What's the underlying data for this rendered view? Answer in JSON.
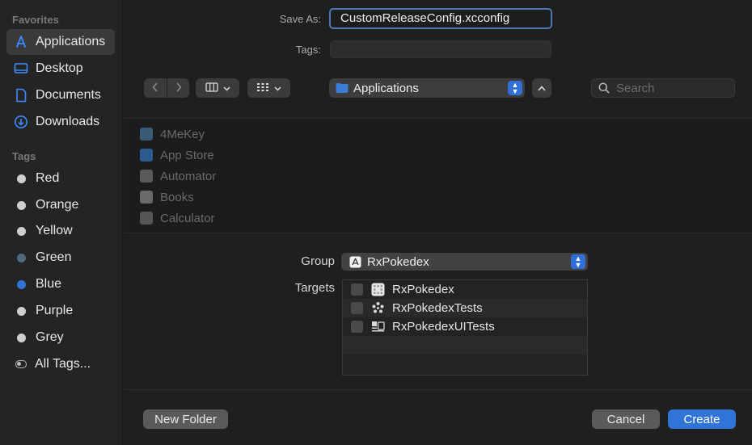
{
  "sidebar": {
    "favorites_header": "Favorites",
    "favorites": [
      {
        "label": "Applications",
        "icon": "applications-icon"
      },
      {
        "label": "Desktop",
        "icon": "desktop-icon"
      },
      {
        "label": "Documents",
        "icon": "document-icon"
      },
      {
        "label": "Downloads",
        "icon": "downloads-icon"
      }
    ],
    "tags_header": "Tags",
    "tags": [
      {
        "label": "Red",
        "color": "#cfcfcf"
      },
      {
        "label": "Orange",
        "color": "#cfcfcf"
      },
      {
        "label": "Yellow",
        "color": "#cfcfcf"
      },
      {
        "label": "Green",
        "color": "#4f6a7e"
      },
      {
        "label": "Blue",
        "color": "#2f74d6"
      },
      {
        "label": "Purple",
        "color": "#cfcfcf"
      },
      {
        "label": "Grey",
        "color": "#cfcfcf"
      }
    ],
    "all_tags": "All Tags..."
  },
  "form": {
    "save_as_label": "Save As:",
    "save_as_value": "CustomReleaseConfig.xcconfig",
    "tags_label": "Tags:"
  },
  "toolbar": {
    "location": "Applications",
    "search_placeholder": "Search"
  },
  "browser": {
    "apps": [
      "4MeKey",
      "App Store",
      "Automator",
      "Books",
      "Calculator"
    ]
  },
  "options": {
    "group_label": "Group",
    "group_value": "RxPokedex",
    "targets_label": "Targets",
    "targets": [
      {
        "label": "RxPokedex",
        "icon": "app-target-icon"
      },
      {
        "label": "RxPokedexTests",
        "icon": "unit-test-icon"
      },
      {
        "label": "RxPokedexUITests",
        "icon": "ui-test-icon"
      }
    ]
  },
  "footer": {
    "new_folder": "New Folder",
    "cancel": "Cancel",
    "create": "Create"
  },
  "colors": {
    "accent": "#2f74d6",
    "focus_ring": "#4a79b3"
  }
}
